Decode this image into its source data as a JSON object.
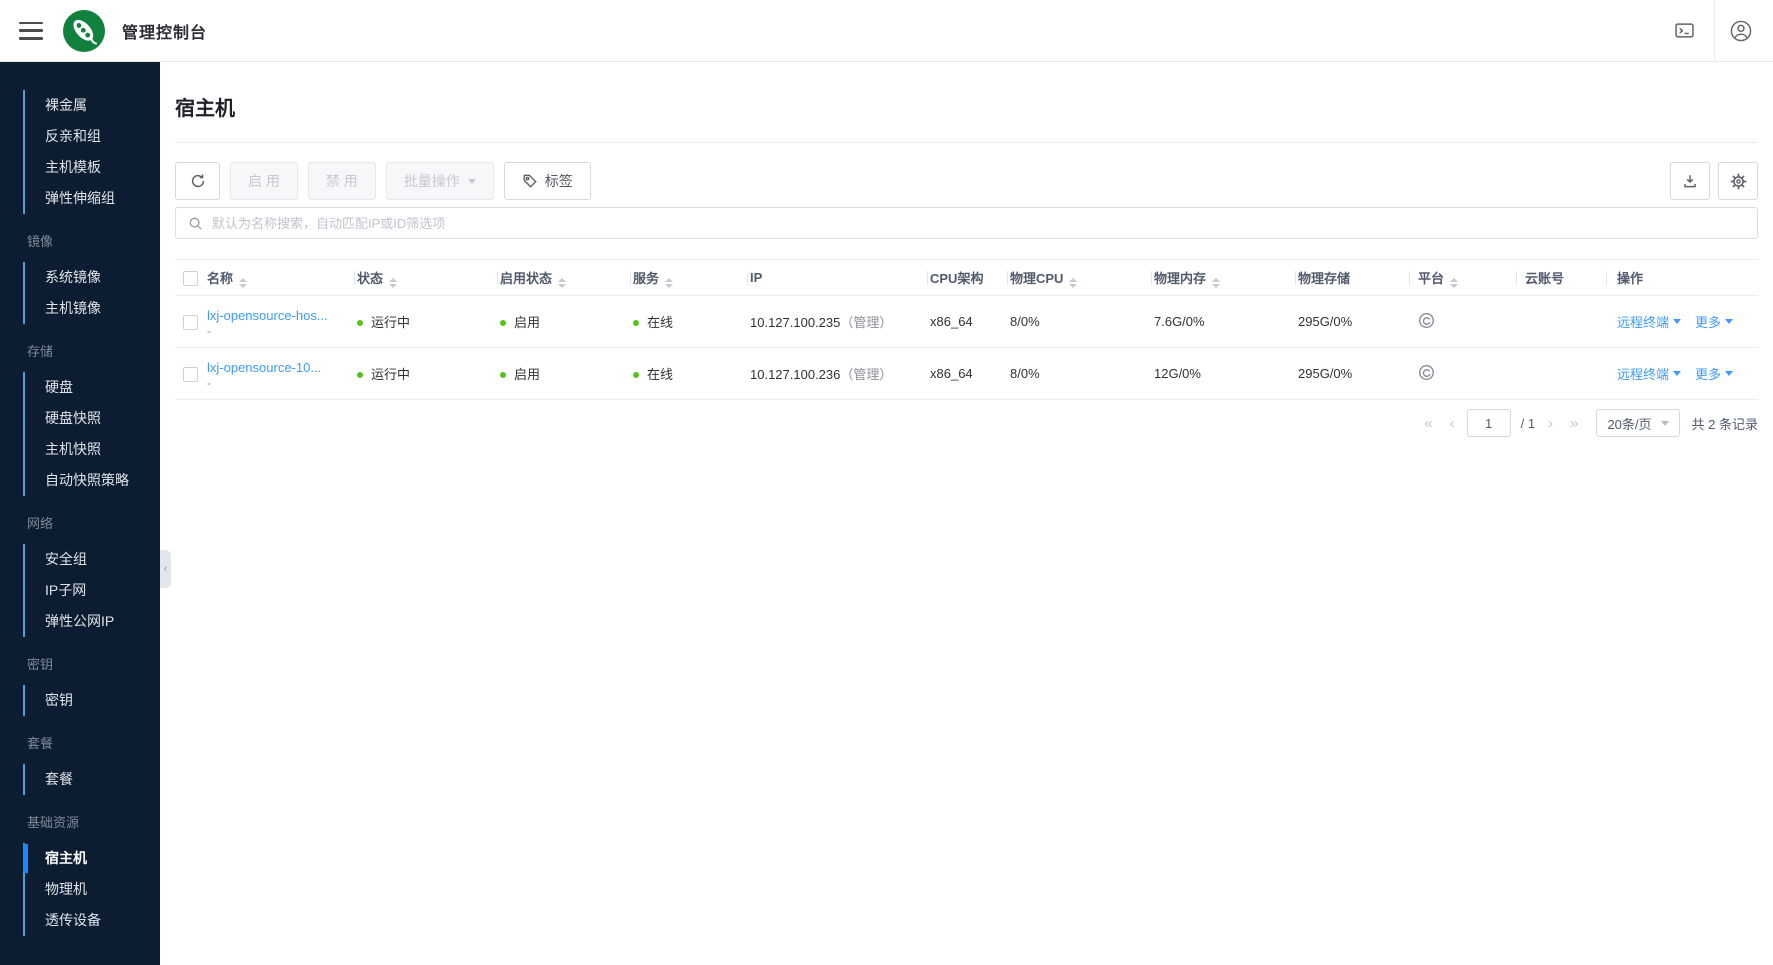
{
  "app": {
    "title": "管理控制台"
  },
  "topbar": {
    "icons": [
      "menu-icon",
      "brand-logo",
      "terminal-icon",
      "user-icon"
    ]
  },
  "colors": {
    "brand_green": "#10823e",
    "accent_blue": "#1789fc",
    "link_blue": "#3d9bfc",
    "status_green": "#52c41a",
    "sidebar_bg": "#0c1d31"
  },
  "sidebar": {
    "sections": [
      {
        "label": "",
        "items": [
          {
            "label": "裸金属",
            "active": false
          },
          {
            "label": "反亲和组",
            "active": false
          },
          {
            "label": "主机模板",
            "active": false
          },
          {
            "label": "弹性伸缩组",
            "active": false
          }
        ]
      },
      {
        "label": "镜像",
        "items": [
          {
            "label": "系统镜像",
            "active": false
          },
          {
            "label": "主机镜像",
            "active": false
          }
        ]
      },
      {
        "label": "存储",
        "items": [
          {
            "label": "硬盘",
            "active": false
          },
          {
            "label": "硬盘快照",
            "active": false
          },
          {
            "label": "主机快照",
            "active": false
          },
          {
            "label": "自动快照策略",
            "active": false
          }
        ]
      },
      {
        "label": "网络",
        "items": [
          {
            "label": "安全组",
            "active": false
          },
          {
            "label": "IP子网",
            "active": false
          },
          {
            "label": "弹性公网IP",
            "active": false
          }
        ]
      },
      {
        "label": "密钥",
        "items": [
          {
            "label": "密钥",
            "active": false
          }
        ]
      },
      {
        "label": "套餐",
        "items": [
          {
            "label": "套餐",
            "active": false
          }
        ]
      },
      {
        "label": "基础资源",
        "items": [
          {
            "label": "宿主机",
            "active": true
          },
          {
            "label": "物理机",
            "active": false
          },
          {
            "label": "透传设备",
            "active": false
          }
        ]
      }
    ]
  },
  "page": {
    "title": "宿主机"
  },
  "toolbar": {
    "refresh_icon": "refresh-icon",
    "enable_label": "启 用",
    "disable_label": "禁 用",
    "batch_label": "批量操作",
    "tag_label": "标签",
    "export_icon": "download-icon",
    "settings_icon": "gear-icon"
  },
  "search": {
    "placeholder": "默认为名称搜索，自动匹配IP或ID筛选项"
  },
  "table": {
    "columns": [
      {
        "key": "checkbox",
        "label": "",
        "sortable": false
      },
      {
        "key": "name",
        "label": "名称",
        "sortable": true
      },
      {
        "key": "status",
        "label": "状态",
        "sortable": true
      },
      {
        "key": "enable_status",
        "label": "启用状态",
        "sortable": true
      },
      {
        "key": "service",
        "label": "服务",
        "sortable": true
      },
      {
        "key": "ip",
        "label": "IP",
        "sortable": false
      },
      {
        "key": "cpu_arch",
        "label": "CPU架构",
        "sortable": false
      },
      {
        "key": "phys_cpu",
        "label": "物理CPU",
        "sortable": true
      },
      {
        "key": "phys_mem",
        "label": "物理内存",
        "sortable": true
      },
      {
        "key": "phys_storage",
        "label": "物理存储",
        "sortable": false
      },
      {
        "key": "platform",
        "label": "平台",
        "sortable": true
      },
      {
        "key": "cloud_account",
        "label": "云账号",
        "sortable": false
      },
      {
        "key": "actions",
        "label": "操作",
        "sortable": false
      }
    ],
    "rows": [
      {
        "name": "lxj-opensource-hos...",
        "name_sub": "-",
        "status": "运行中",
        "enable_status": "启用",
        "service": "在线",
        "ip": "10.127.100.235",
        "ip_note": "（管理）",
        "cpu_arch": "x86_64",
        "phys_cpu": "8/0%",
        "phys_mem": "7.6G/0%",
        "phys_storage": "295G/0%",
        "platform": "onecloud-platform-icon",
        "cloud_account": "",
        "actions": [
          "远程终端",
          "更多"
        ]
      },
      {
        "name": "lxj-opensource-10...",
        "name_sub": "-",
        "status": "运行中",
        "enable_status": "启用",
        "service": "在线",
        "ip": "10.127.100.236",
        "ip_note": "（管理）",
        "cpu_arch": "x86_64",
        "phys_cpu": "8/0%",
        "phys_mem": "12G/0%",
        "phys_storage": "295G/0%",
        "platform": "onecloud-platform-icon",
        "cloud_account": "",
        "actions": [
          "远程终端",
          "更多"
        ]
      }
    ]
  },
  "pagination": {
    "first": "«",
    "prev": "‹",
    "page": "1",
    "page_total": "/ 1",
    "next": "›",
    "last": "»",
    "page_size": "20条/页",
    "total_records": "共 2 条记录"
  }
}
